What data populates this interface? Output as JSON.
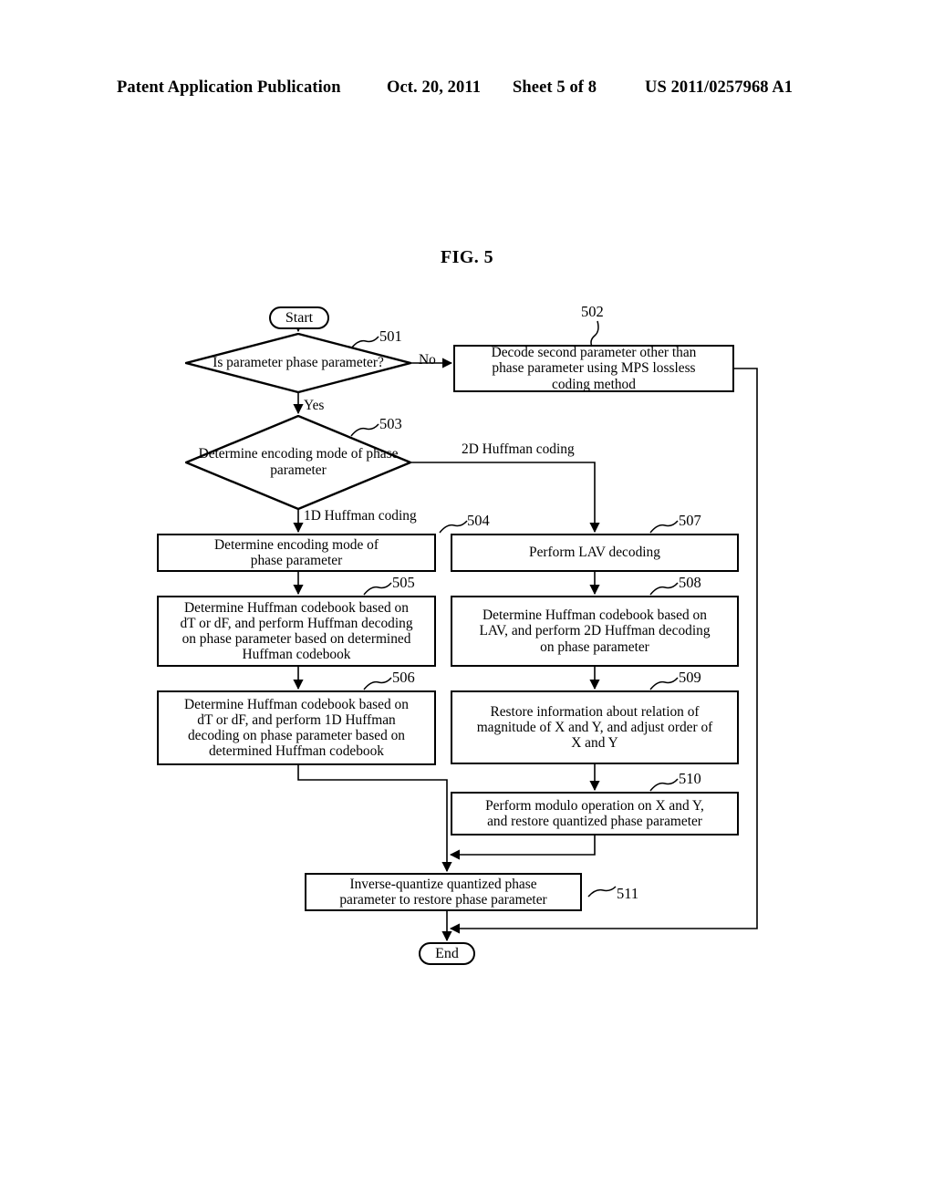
{
  "header": {
    "publication": "Patent Application Publication",
    "date": "Oct. 20, 2011",
    "sheet": "Sheet 5 of 8",
    "patent_number": "US 2011/0257968 A1"
  },
  "figure": {
    "title": "FIG. 5"
  },
  "flowchart": {
    "start_label": "Start",
    "end_label": "End",
    "nodes": [
      {
        "ref": "501",
        "type": "decision",
        "text": "Is parameter\nphase parameter?"
      },
      {
        "ref": "502",
        "type": "process",
        "text": "Decode second parameter other than\nphase parameter using MPS lossless\ncoding method"
      },
      {
        "ref": "503",
        "type": "decision",
        "text": "Determine\nencoding mode of\nphase parameter"
      },
      {
        "ref": "504",
        "type": "process",
        "text": "Determine encoding mode of\nphase parameter"
      },
      {
        "ref": "505",
        "type": "process",
        "text": "Determine Huffman codebook based on\ndT or dF, and perform Huffman decoding\non phase parameter based on determined\nHuffman codebook"
      },
      {
        "ref": "506",
        "type": "process",
        "text": "Determine Huffman codebook based on\ndT or dF, and perform 1D Huffman\ndecoding on phase parameter based on\ndetermined Huffman codebook"
      },
      {
        "ref": "507",
        "type": "process",
        "text": "Perform LAV decoding"
      },
      {
        "ref": "508",
        "type": "process",
        "text": "Determine Huffman codebook based on\nLAV, and perform 2D Huffman decoding\non phase parameter"
      },
      {
        "ref": "509",
        "type": "process",
        "text": "Restore information about relation of\nmagnitude of X and Y, and adjust order of\nX and Y"
      },
      {
        "ref": "510",
        "type": "process",
        "text": "Perform modulo operation on X and Y,\nand restore quantized phase parameter"
      },
      {
        "ref": "511",
        "type": "process",
        "text": "Inverse-quantize quantized phase\nparameter to restore phase parameter"
      }
    ],
    "edge_labels": {
      "no": "No",
      "yes": "Yes",
      "coding_1d": "1D Huffman coding",
      "coding_2d": "2D Huffman coding"
    },
    "node_text": {
      "n501_l1": "Is parameter",
      "n501_l2": "phase parameter?",
      "n502_l1": "Decode second parameter other than",
      "n502_l2": "phase parameter using MPS lossless",
      "n502_l3": "coding method",
      "n503_l1": "Determine",
      "n503_l2": "encoding mode of",
      "n503_l3": "phase parameter",
      "n504_l1": "Determine encoding mode of",
      "n504_l2": "phase parameter",
      "n505_l1": "Determine Huffman codebook based on",
      "n505_l2": "dT or dF, and perform Huffman decoding",
      "n505_l3": "on phase parameter based on determined",
      "n505_l4": "Huffman codebook",
      "n506_l1": "Determine Huffman codebook based on",
      "n506_l2": "dT or dF, and perform 1D Huffman",
      "n506_l3": "decoding on phase parameter based on",
      "n506_l4": "determined Huffman codebook",
      "n507_l1": "Perform LAV decoding",
      "n508_l1": "Determine Huffman codebook based on",
      "n508_l2": "LAV, and perform 2D Huffman decoding",
      "n508_l3": "on phase parameter",
      "n509_l1": "Restore information about relation of",
      "n509_l2": "magnitude of X and Y, and adjust order of",
      "n509_l3": "X and Y",
      "n510_l1": "Perform modulo operation on X and Y,",
      "n510_l2": "and restore quantized phase parameter",
      "n511_l1": "Inverse-quantize quantized phase",
      "n511_l2": "parameter to restore phase parameter"
    },
    "refs": {
      "r501": "501",
      "r502": "502",
      "r503": "503",
      "r504": "504",
      "r505": "505",
      "r506": "506",
      "r507": "507",
      "r508": "508",
      "r509": "509",
      "r510": "510",
      "r511": "511"
    }
  },
  "colors": {
    "ink": "#000000",
    "paper": "#ffffff"
  }
}
